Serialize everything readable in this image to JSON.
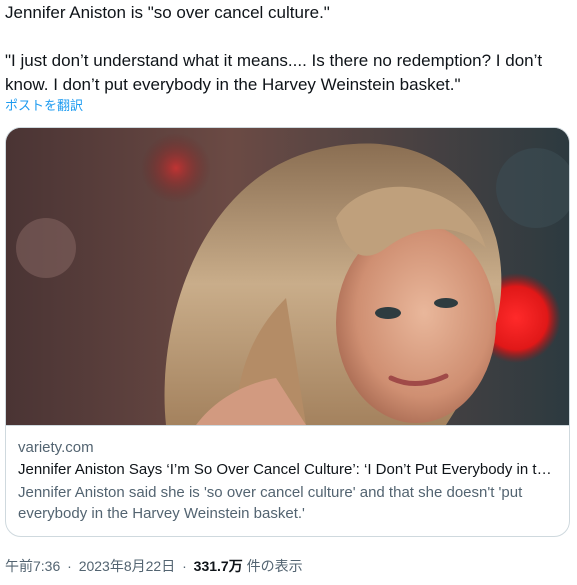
{
  "tweet": {
    "line1": "Jennifer Aniston is \"so over cancel culture.\"",
    "line2": "\"I just don’t understand what it means.... Is there no redemption? I don’t know. I don’t put everybody in the Harvey Weinstein basket.\"",
    "translate_label": "ポストを翻訳"
  },
  "card": {
    "domain": "variety.com",
    "title": "Jennifer Aniston Says ‘I’m So Over Cancel Culture’: ‘I Don’t Put Everybody in the Harvey Weinstein Basket’",
    "description": "Jennifer Aniston said she is 'so over cancel culture' and that she doesn't 'put everybody in the Harvey Weinstein basket.'"
  },
  "meta": {
    "time": "午前7:36",
    "date": "2023年8月22日",
    "separator": "·",
    "views_count": "331.7万",
    "views_label": "件の表示"
  },
  "colors": {
    "link_blue": "#1d9bf0",
    "text_primary": "#0f1419",
    "text_secondary": "#536471",
    "border": "#cfd9de"
  }
}
